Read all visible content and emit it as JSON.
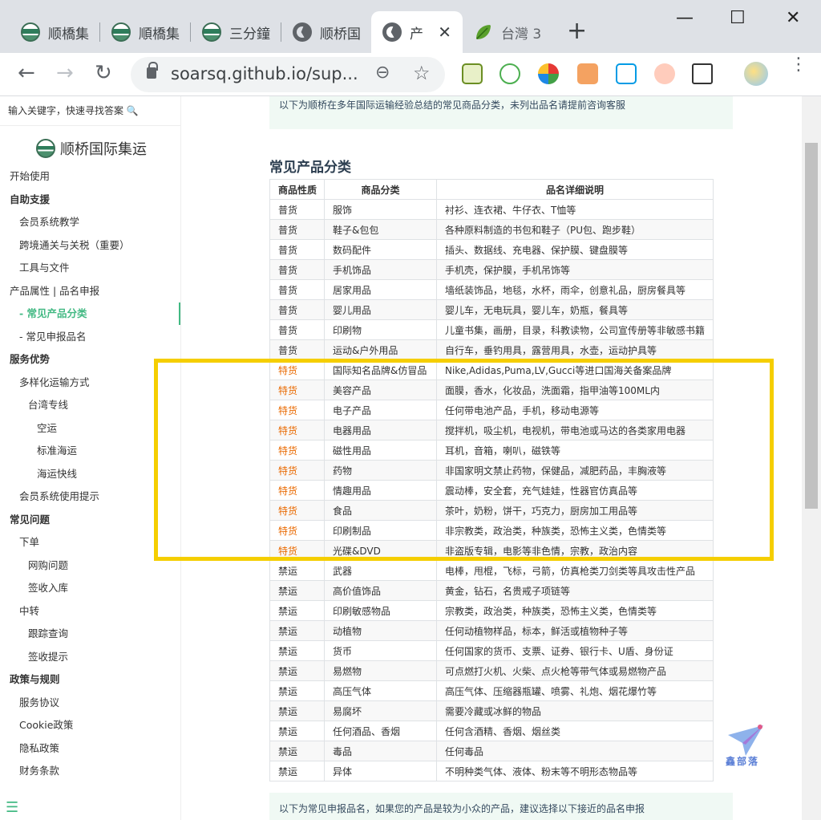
{
  "browser": {
    "tabs": [
      {
        "title": "顺橋集",
        "icon": "island-logo",
        "left": 0
      },
      {
        "title": "順橋集",
        "icon": "island-logo"
      },
      {
        "title": "三分鐘",
        "icon": "island-logo"
      },
      {
        "title": "顺桥国",
        "icon": "globe"
      },
      {
        "title": "产",
        "icon": "globe",
        "active": true
      },
      {
        "title": "台灣 3",
        "icon": "leaf"
      }
    ],
    "new_tab": "+",
    "minimize": "—",
    "maximize": "☐",
    "close": "✕",
    "url": "soarsq.github.io/sup..."
  },
  "sidebar": {
    "search_placeholder": "输入关键字，快速寻找答案 🔍",
    "brand": "顺桥国际集运",
    "items": [
      {
        "label": "开始使用",
        "level": 0,
        "bold": false
      },
      {
        "label": "自助支援",
        "level": 0,
        "bold": true
      },
      {
        "label": "会员系统教学",
        "level": 1
      },
      {
        "label": "跨境通关与关税（重要）",
        "level": 1
      },
      {
        "label": "工具与文件",
        "level": 1
      },
      {
        "label": "产品属性 | 品名申报",
        "level": 0
      },
      {
        "label": "- 常见产品分类",
        "level": 1,
        "active": true
      },
      {
        "label": "- 常见申报品名",
        "level": 1
      },
      {
        "label": "服务优势",
        "level": 0,
        "bold": true
      },
      {
        "label": "多样化运输方式",
        "level": 1
      },
      {
        "label": "台湾专线",
        "level": 2
      },
      {
        "label": "空运",
        "level": 3
      },
      {
        "label": "标准海运",
        "level": 3
      },
      {
        "label": "海运快线",
        "level": 3
      },
      {
        "label": "会员系统使用提示",
        "level": 1
      },
      {
        "label": "常见问题",
        "level": 0,
        "bold": true
      },
      {
        "label": "下单",
        "level": 1
      },
      {
        "label": "网购问题",
        "level": 2
      },
      {
        "label": "签收入库",
        "level": 2
      },
      {
        "label": "中转",
        "level": 1
      },
      {
        "label": "跟踪查询",
        "level": 2
      },
      {
        "label": "签收提示",
        "level": 2
      },
      {
        "label": "政策与规则",
        "level": 0,
        "bold": true
      },
      {
        "label": "服务协议",
        "level": 1
      },
      {
        "label": "Cookie政策",
        "level": 1
      },
      {
        "label": "隐私政策",
        "level": 1
      },
      {
        "label": "财务条款",
        "level": 1
      }
    ],
    "menu_icon": "☰"
  },
  "main": {
    "tip_top": "以下为顺桥在多年国际运输经验总结的常见商品分类，未列出品名请提前咨询客服",
    "section_title": "常见产品分类",
    "tip_bottom": "以下为常见申报品名，如果您的产品是较为小众的产品，建议选择以下接近的品名申报",
    "table": {
      "headers": [
        "商品性质",
        "商品分类",
        "品名详细说明"
      ],
      "rows": [
        [
          "普货",
          "服饰",
          "衬衫、连衣裙、牛仔衣、T恤等"
        ],
        [
          "普货",
          "鞋子&包包",
          "各种原料制造的书包和鞋子（PU包、跑步鞋）"
        ],
        [
          "普货",
          "数码配件",
          "插头、数据线、充电器、保护膜、键盘膜等"
        ],
        [
          "普货",
          "手机饰品",
          "手机壳，保护膜，手机吊饰等"
        ],
        [
          "普货",
          "居家用品",
          "墙纸装饰品，地毯，水杯，雨伞，创意礼品，厨房餐具等"
        ],
        [
          "普货",
          "婴儿用品",
          "婴儿车，无电玩具，婴儿车，奶瓶，餐具等"
        ],
        [
          "普货",
          "印刷物",
          "儿童书集，画册，目录，科教读物，公司宣传册等非敏感书籍"
        ],
        [
          "普货",
          "运动&户外用品",
          "自行车，垂钓用具，露营用具，水壶，运动护具等"
        ],
        [
          "特货",
          "国际知名品牌&仿冒品",
          "Nike,Adidas,Puma,LV,Gucci等进口国海关备案品牌"
        ],
        [
          "特货",
          "美容产品",
          "面膜，香水，化妆品，洗面霜，指甲油等100ML内"
        ],
        [
          "特货",
          "电子产品",
          "任何带电池产品，手机，移动电源等"
        ],
        [
          "特货",
          "电器用品",
          "搅拌机，吸尘机，电视机，带电池或马达的各类家用电器"
        ],
        [
          "特货",
          "磁性用品",
          "耳机，音箱，喇叭，磁铁等"
        ],
        [
          "特货",
          "药物",
          "非国家明文禁止药物，保健品，减肥药品，丰胸液等"
        ],
        [
          "特货",
          "情趣用品",
          "震动棒，安全套，充气娃娃，性器官仿真品等"
        ],
        [
          "特货",
          "食品",
          "茶叶，奶粉，饼干，巧克力，厨房加工用品等"
        ],
        [
          "特货",
          "印刷制品",
          "非宗教类，政治类，种族类，恐怖主义类，色情类等"
        ],
        [
          "特货",
          "光碟&DVD",
          "非盗版专辑，电影等非色情，宗教，政治内容"
        ],
        [
          "禁运",
          "武器",
          "电棒，甩棍，飞标，弓箭，仿真枪类刀剑类等具攻击性产品"
        ],
        [
          "禁运",
          "高价值饰品",
          "黄金，钻石，名贵戒子项链等"
        ],
        [
          "禁运",
          "印刷敏感物品",
          "宗教类，政治类，种族类，恐怖主义类，色情类等"
        ],
        [
          "禁运",
          "动植物",
          "任何动植物样品，标本，鲜活或植物种子等"
        ],
        [
          "禁运",
          "货币",
          "任何国家的货币、支票、证券、银行卡、U盾、身份证"
        ],
        [
          "禁运",
          "易燃物",
          "可点燃打火机、火柴、点火枪等带气体或易燃物产品"
        ],
        [
          "禁运",
          "高压气体",
          "高压气体、压缩器瓶罐、喷雾、礼炮、烟花爆竹等"
        ],
        [
          "禁运",
          "易腐坏",
          "需要冷藏或冰鲜的物品"
        ],
        [
          "禁运",
          "任何酒品、香烟",
          "任何含酒精、香烟、烟丝类"
        ],
        [
          "禁运",
          "毒品",
          "任何毒品"
        ],
        [
          "禁运",
          "异体",
          "不明种类气体、液体、粉末等不明形态物品等"
        ]
      ]
    }
  },
  "watermark": "鑫部落",
  "colors": {
    "accent": "#42b983",
    "special": "#e96900",
    "highlight": "#f5ce00"
  }
}
